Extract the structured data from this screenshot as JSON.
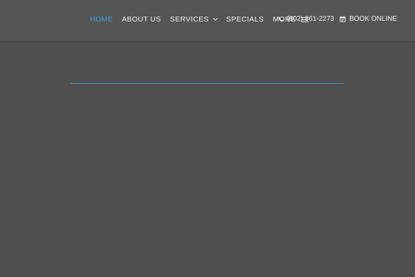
{
  "nav": {
    "items": [
      {
        "label": "HOME",
        "active": true
      },
      {
        "label": "ABOUT US",
        "active": false
      },
      {
        "label": "SERVICES",
        "active": false
      },
      {
        "label": "SPECIALS",
        "active": false
      },
      {
        "label": "MORE",
        "active": false
      }
    ],
    "services_icon": "chevron-down-icon",
    "more_icon": "hamburger-menu-icon"
  },
  "contact": {
    "phone": "(802) 861-2273",
    "phone_icon": "phone-icon",
    "book_label": "BOOK ONLINE",
    "book_icon": "calendar-icon"
  },
  "colors": {
    "background": "#4f4f4f",
    "header": "#555555",
    "accent": "#3aa2dc",
    "text": "#f2f2f2"
  }
}
